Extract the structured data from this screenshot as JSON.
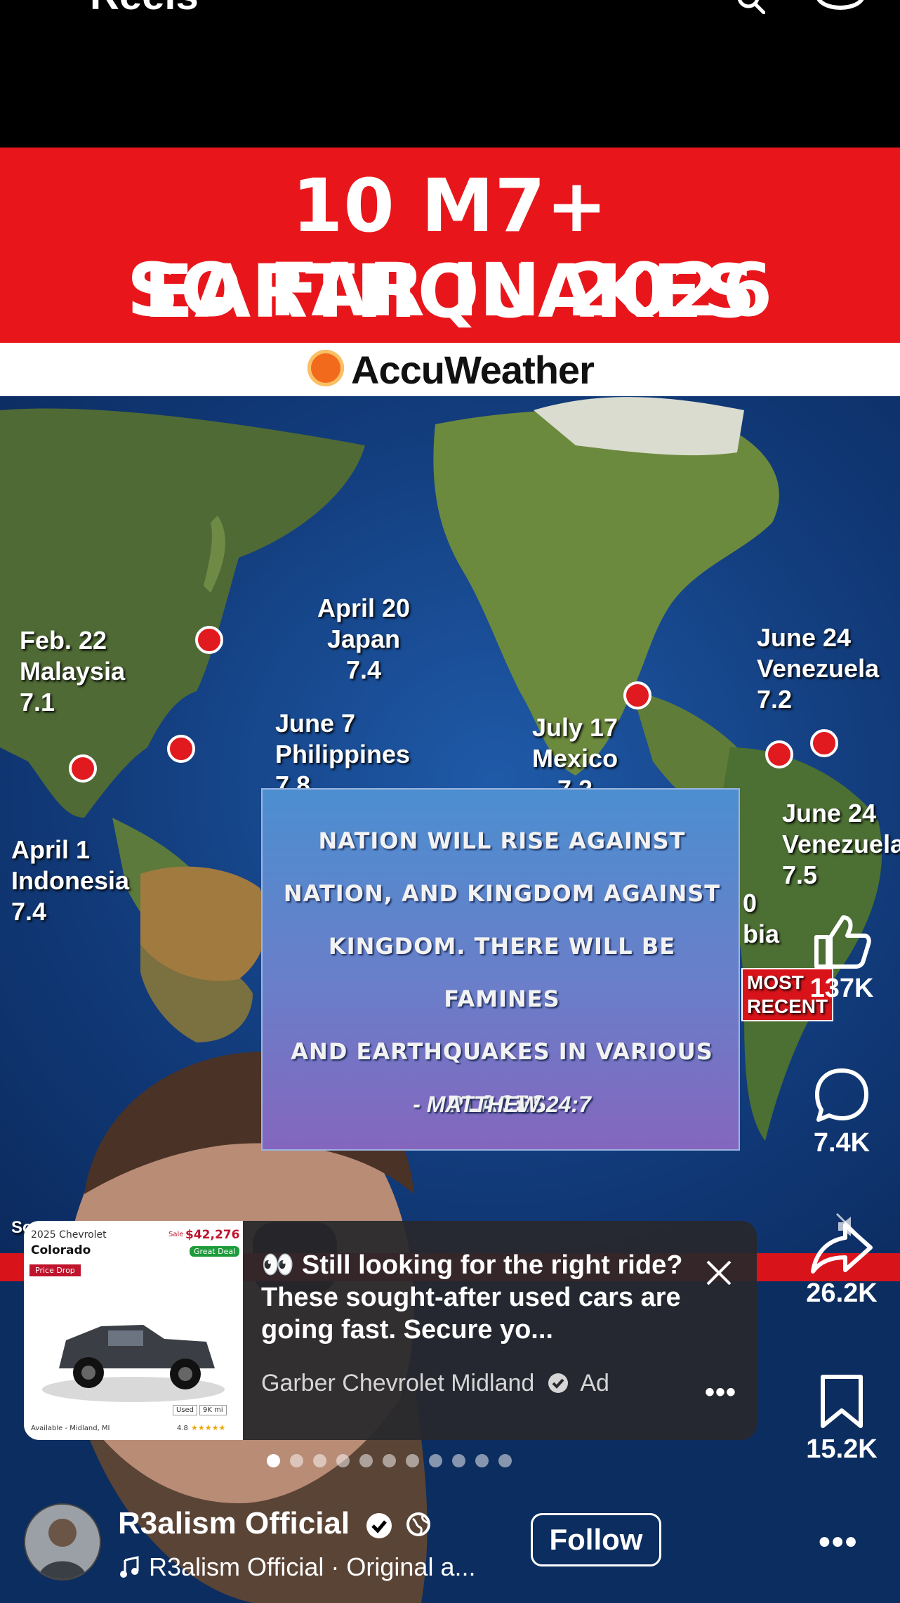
{
  "top_bar": {
    "title": "Reels"
  },
  "video": {
    "headline_line1": "10 M7+ EARTHQUAKES",
    "headline_line2": "SO FAR IN 2026",
    "brand": "AccuWeather",
    "quakes": [
      {
        "date": "Feb. 22",
        "place": "Malaysia",
        "mag": "7.1"
      },
      {
        "date": "April 20",
        "place": "Japan",
        "mag": "7.4"
      },
      {
        "date": "June 7",
        "place": "Philippines",
        "mag": "7.8"
      },
      {
        "date": "April 1",
        "place": "Indonesia",
        "mag": "7.4"
      },
      {
        "date": "July 17",
        "place": "Mexico",
        "mag": "7.2"
      },
      {
        "date": "June 24",
        "place": "Venezuela",
        "mag": "7.2"
      },
      {
        "date": "June 24",
        "place": "Venezuela",
        "mag": "7.5"
      }
    ],
    "partial_label_1": "0",
    "partial_label_2": "bia",
    "most_recent_1": "MOST",
    "most_recent_2": "RECENT",
    "source_fragment": "So",
    "verse_lines": [
      "NATION WILL RISE AGAINST",
      "NATION, AND KINGDOM AGAINST",
      "KINGDOM. THERE WILL BE FAMINES",
      "AND EARTHQUAKES IN VARIOUS",
      "PLACES."
    ],
    "verse_ref": "- MATTHEW 24:7"
  },
  "rail": {
    "likes": "137K",
    "comments": "7.4K",
    "shares": "26.2K",
    "saves": "15.2K"
  },
  "ad": {
    "thumb_year_model": "2025 Chevrolet",
    "thumb_model": "Colorado",
    "thumb_sale_label": "Sale",
    "thumb_price": "$42,276",
    "thumb_deal": "Great Deal",
    "thumb_price_drop": "Price Drop",
    "thumb_used": "Used",
    "thumb_miles": "9K mi",
    "thumb_location": "Available - Midland, MI",
    "thumb_rating": "4.8",
    "text": "👀 Still looking for the right ride? These sought-after used cars are going fast. Secure yo...",
    "sponsor": "Garber Chevrolet Midland",
    "ad_label": "Ad",
    "more": "•••"
  },
  "pager": {
    "count": 11,
    "active": 0
  },
  "bottom": {
    "author": "R3alism Official",
    "audio": "R3alism Official · Original a...",
    "follow": "Follow",
    "more": "•••"
  }
}
